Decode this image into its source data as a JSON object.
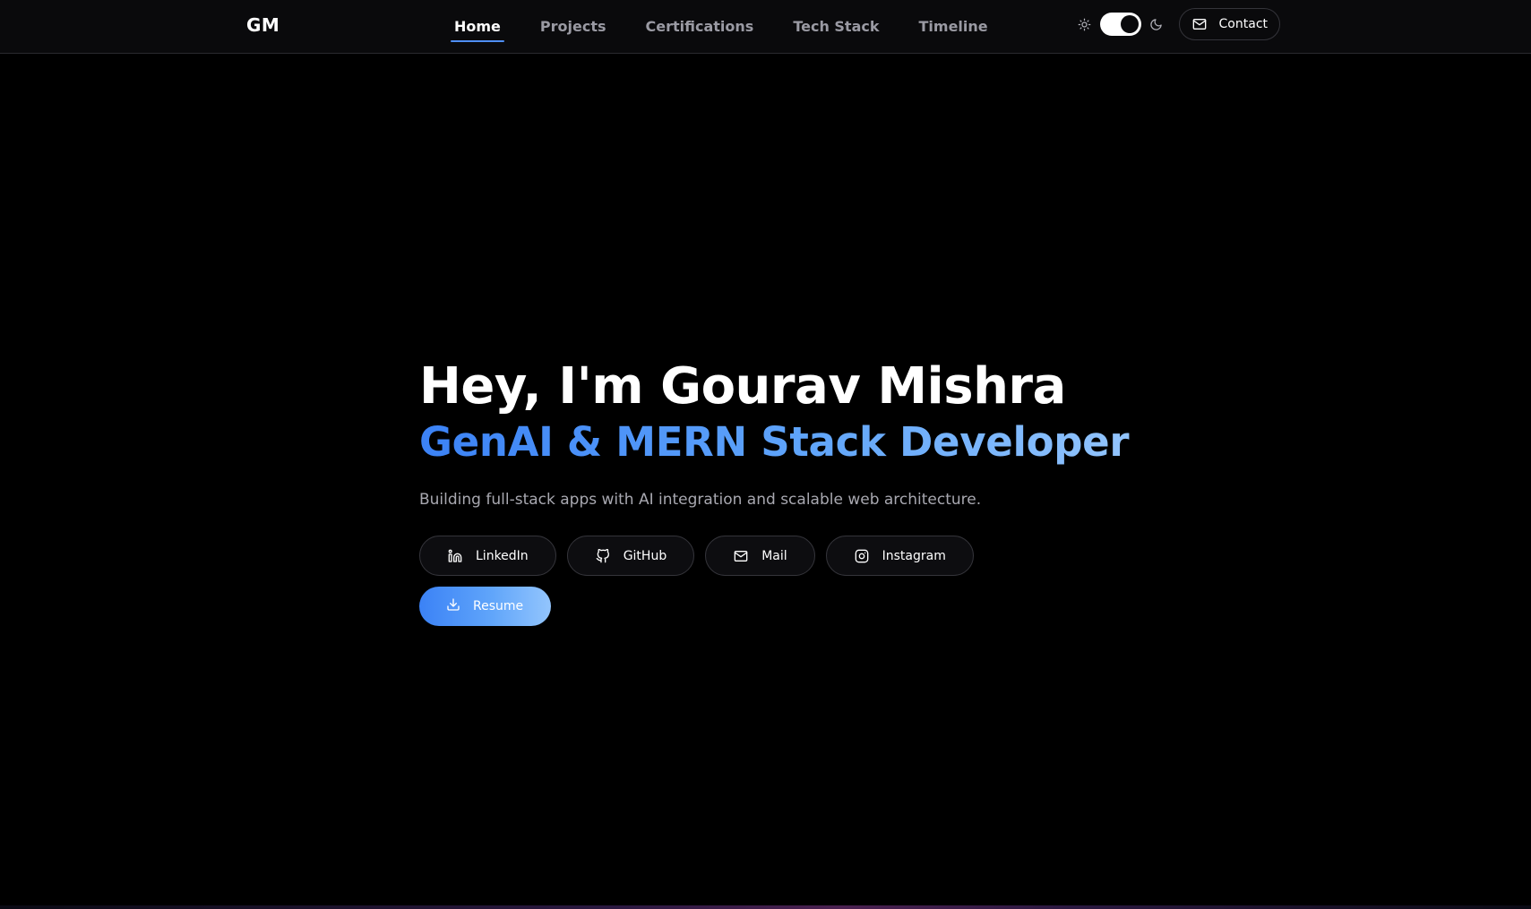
{
  "nav": {
    "logo": "GM",
    "links": [
      {
        "label": "Home",
        "active": true
      },
      {
        "label": "Projects",
        "active": false
      },
      {
        "label": "Certifications",
        "active": false
      },
      {
        "label": "Tech Stack",
        "active": false
      },
      {
        "label": "Timeline",
        "active": false
      }
    ],
    "theme_toggle": {
      "state": "dark",
      "light_icon": "sun-icon",
      "dark_icon": "moon-icon"
    },
    "contact_label": "Contact",
    "contact_icon": "mail-icon"
  },
  "hero": {
    "title": "Hey, I'm Gourav Mishra",
    "subtitle": "GenAI & MERN Stack Developer",
    "description": "Building full-stack apps with AI integration and scalable web architecture.",
    "links": [
      {
        "label": "LinkedIn",
        "icon": "linkedin-icon"
      },
      {
        "label": "GitHub",
        "icon": "github-icon"
      },
      {
        "label": "Mail",
        "icon": "mail-icon"
      },
      {
        "label": "Instagram",
        "icon": "instagram-icon"
      }
    ],
    "resume": {
      "label": "Resume",
      "icon": "download-icon"
    }
  },
  "colors": {
    "background": "#000000",
    "navbar": "#0a0a0c",
    "accent_start": "#3b82f6",
    "accent_end": "#93c5fd",
    "muted_text": "#9a9aa3"
  }
}
